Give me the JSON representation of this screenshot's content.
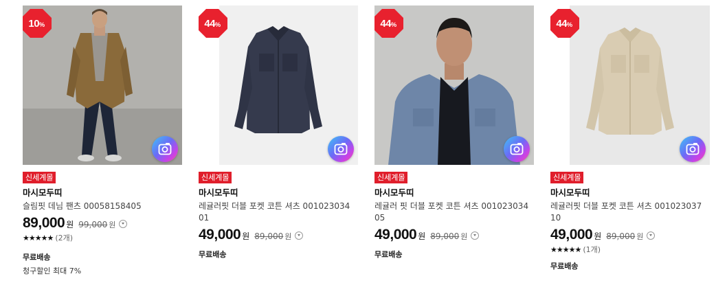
{
  "colors": {
    "badge_red": "#e01e2b",
    "discount_red": "#e8212e",
    "price_text": "#111111"
  },
  "products": [
    {
      "discount": "10",
      "discount_unit": "%",
      "tag": "신세계몰",
      "brand": "마시모두띠",
      "name": "슬림핏 데님 팬츠 00058158405",
      "price": "89,000",
      "price_unit": "원",
      "original_price": "99,000",
      "original_unit": "원",
      "stars": "★★★★★",
      "review_count": "(2개)",
      "shipping": "무료배송",
      "extra": "청구할인 최대 7%",
      "image_icon": "camera-icon"
    },
    {
      "discount": "44",
      "discount_unit": "%",
      "tag": "신세계몰",
      "brand": "마시모두띠",
      "name": "레귤러핏 더블 포켓 코튼 셔츠 00102303401",
      "price": "49,000",
      "price_unit": "원",
      "original_price": "89,000",
      "original_unit": "원",
      "shipping": "무료배송",
      "image_icon": "camera-icon"
    },
    {
      "discount": "44",
      "discount_unit": "%",
      "tag": "신세계몰",
      "brand": "마시모두띠",
      "name": "레귤러 핏 더블 포켓 코튼 셔츠 00102303405",
      "price": "49,000",
      "price_unit": "원",
      "original_price": "89,000",
      "original_unit": "원",
      "shipping": "무료배송",
      "image_icon": "camera-icon"
    },
    {
      "discount": "44",
      "discount_unit": "%",
      "tag": "신세계몰",
      "brand": "마시모두띠",
      "name": "레귤러핏 더블 포켓 코튼 셔츠 00102303710",
      "price": "49,000",
      "price_unit": "원",
      "original_price": "89,000",
      "original_unit": "원",
      "stars": "★★★★★",
      "review_count": "(1개)",
      "shipping": "무료배송",
      "image_icon": "camera-icon"
    }
  ]
}
